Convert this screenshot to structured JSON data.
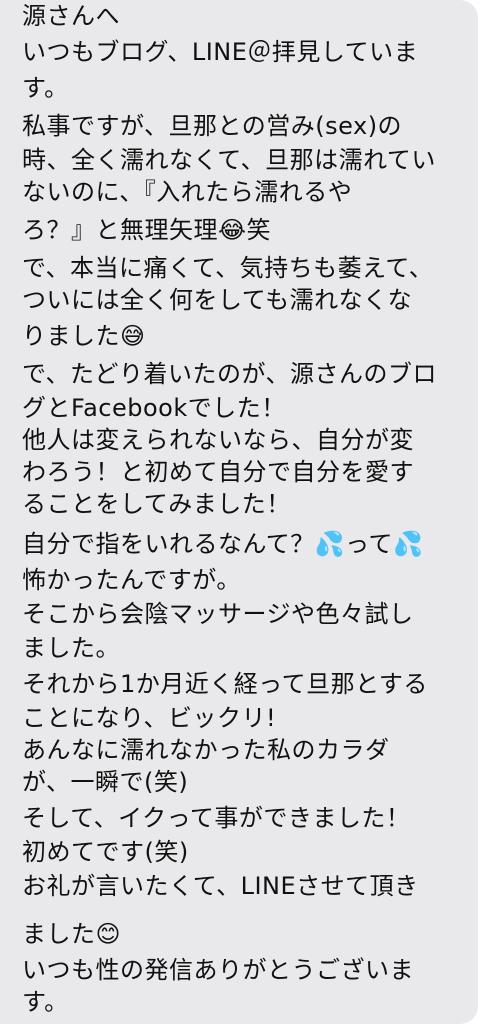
{
  "message": {
    "lines": [
      "源さんへ",
      "いつもブログ、LINE＠拝見していま",
      "す。",
      "私事ですが、旦那との営み(sex)の",
      "時、全く濡れなくて、旦那は濡れてい",
      "ないのに、『入れたら濡れるや",
      "ろ？』と無理矢理😂笑",
      "で、本当に痛くて、気持ちも萎えて、",
      "ついには全く何をしても濡れなくな",
      "りました😅",
      "で、たどり着いたのが、源さんのブロ",
      "グとFacebookでした！",
      "他人は変えられないなら、自分が変",
      "わろう！と初めて自分で自分を愛す",
      "ることをしてみました！",
      "自分で指をいれるなんて？💦って💦",
      "怖かったんですが。",
      "そこから会陰マッサージや色々試し",
      "ました。",
      "それから1か月近く経って旦那とする",
      "ことになり、ビックリ!",
      "あんなに濡れなかった私のカラダ",
      "が、一瞬で(笑)",
      "そして、イクって事ができました！",
      "初めてです(笑)",
      "お礼が言いたくて、LINEさせて頂き",
      "ました😊",
      "いつも性の発信ありがとうございま",
      "す。"
    ]
  }
}
